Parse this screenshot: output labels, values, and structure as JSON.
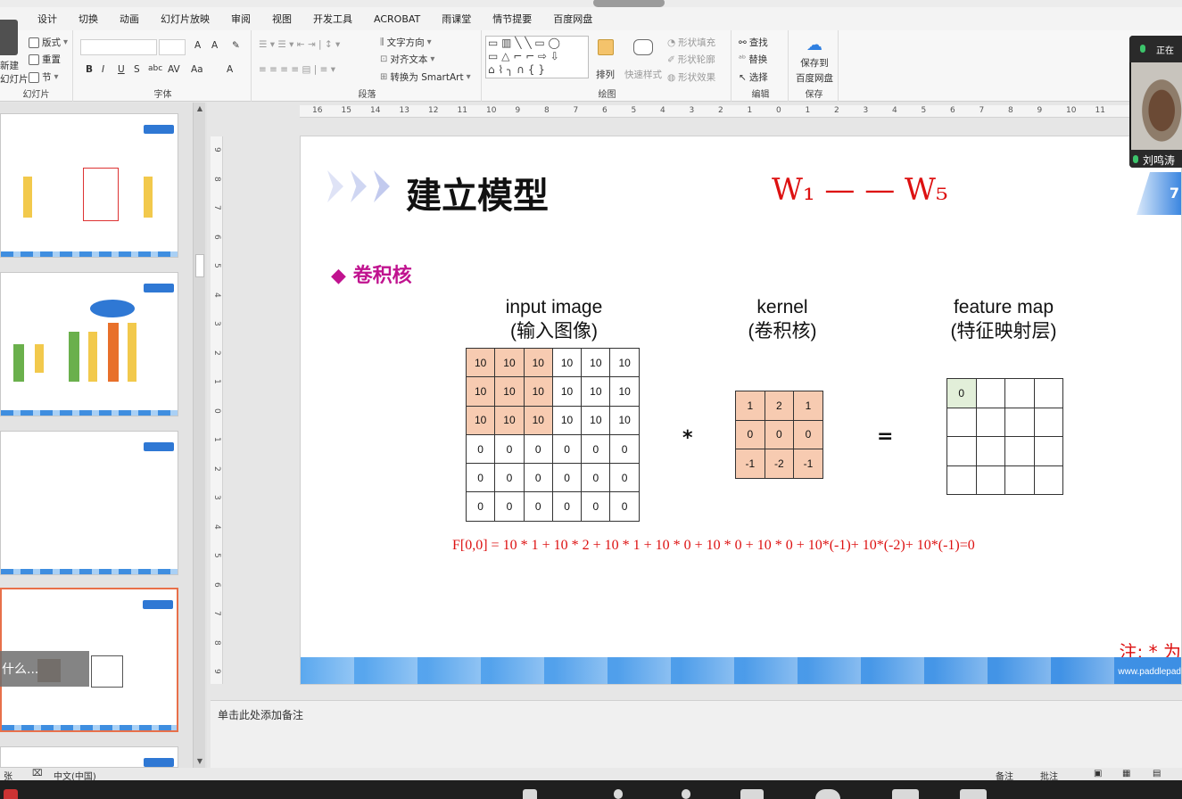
{
  "ribbon_tabs": [
    "设计",
    "切换",
    "动画",
    "幻灯片放映",
    "审阅",
    "视图",
    "开发工具",
    "ACROBAT",
    "雨课堂",
    "情节提要",
    "百度网盘"
  ],
  "groups": {
    "slides": {
      "label": "幻灯片",
      "new_slide": "新建",
      "new_slide2": "幻灯片",
      "layout": "版式",
      "reset": "重置",
      "section": "节"
    },
    "font": {
      "label": "字体",
      "grow": "A",
      "shrink": "A",
      "bold": "B",
      "italic": "I",
      "underline": "U",
      "shadow": "S",
      "strike": "abc",
      "spacing": "AV",
      "case": "Aa",
      "color": "A"
    },
    "paragraph": {
      "label": "段落",
      "text_direction": "文字方向",
      "align_text": "对齐文本",
      "smartart": "转换为 SmartArt"
    },
    "drawing": {
      "label": "绘图",
      "arrange": "排列",
      "quick_styles": "快速样式",
      "shape_fill": "形状填充",
      "shape_outline": "形状轮廓",
      "shape_effects": "形状效果"
    },
    "editing": {
      "label": "编辑",
      "find": "查找",
      "replace": "替换",
      "select": "选择"
    },
    "save": {
      "label": "保存",
      "save_to": "保存到",
      "baidu": "百度网盘"
    }
  },
  "ruler_h": [
    "16",
    "15",
    "14",
    "13",
    "12",
    "11",
    "10",
    "9",
    "8",
    "7",
    "6",
    "5",
    "4",
    "3",
    "2",
    "1",
    "0",
    "1",
    "2",
    "3",
    "4",
    "5",
    "6",
    "7",
    "8",
    "9",
    "10",
    "11"
  ],
  "ruler_v": [
    "9",
    "8",
    "7",
    "6",
    "5",
    "4",
    "3",
    "2",
    "1",
    "0",
    "1",
    "2",
    "3",
    "4",
    "5",
    "6",
    "7",
    "8",
    "9"
  ],
  "slide": {
    "title": "建立模型",
    "bullet": "◆ 卷积核",
    "handwriting": "W₁  —  —  W₅",
    "input_caption": [
      "input image",
      "(输入图像)"
    ],
    "kernel_caption": [
      "kernel",
      "(卷积核)"
    ],
    "feature_caption": [
      "feature map",
      "(特征映射层)"
    ],
    "input_matrix": [
      [
        "10",
        "10",
        "10",
        "10",
        "10",
        "10"
      ],
      [
        "10",
        "10",
        "10",
        "10",
        "10",
        "10"
      ],
      [
        "10",
        "10",
        "10",
        "10",
        "10",
        "10"
      ],
      [
        "0",
        "0",
        "0",
        "0",
        "0",
        "0"
      ],
      [
        "0",
        "0",
        "0",
        "0",
        "0",
        "0"
      ],
      [
        "0",
        "0",
        "0",
        "0",
        "0",
        "0"
      ]
    ],
    "kernel_matrix": [
      [
        "1",
        "2",
        "1"
      ],
      [
        "0",
        "0",
        "0"
      ],
      [
        "-1",
        "-2",
        "-1"
      ]
    ],
    "feature_matrix": [
      [
        "0",
        "",
        "",
        ""
      ],
      [
        "",
        "",
        "",
        ""
      ],
      [
        "",
        "",
        "",
        ""
      ],
      [
        "",
        "",
        "",
        ""
      ]
    ],
    "multiply": "*",
    "equals": "=",
    "formula": "F[0,0] = 10 * 1 + 10 * 2 + 10 * 1 + 10 * 0 + 10 * 0 + 10 * 0 + 10*(-1)+ 10*(-2)+ 10*(-1)=0",
    "note": "注: * 为",
    "band_url": "www.paddlepad",
    "corner_badge": "7",
    "colors": {
      "highlight": "#f7cbb1",
      "feature_first": "#e2efd9",
      "title_pink": "#c0138f",
      "formula_red": "#d11111"
    }
  },
  "notes_placeholder": "单击此处添加备注",
  "status": {
    "slide_count": "张",
    "lang": "中文(中国)",
    "notes": "备注",
    "comments": "批注"
  },
  "video": {
    "speaking": "正在",
    "name": "刘鸣涛"
  },
  "toast": "什么..."
}
